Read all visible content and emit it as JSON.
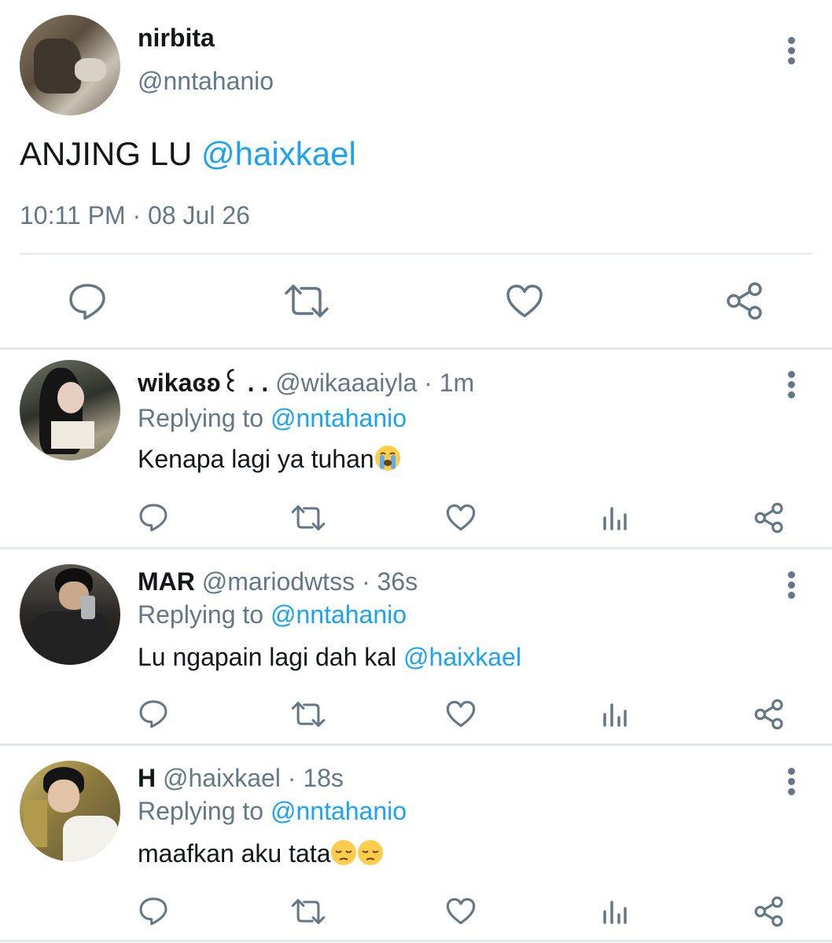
{
  "main_tweet": {
    "display_name": "nirbita",
    "handle": "@nntahanio",
    "text": "ANJING LU ",
    "mention": "@haixkael",
    "timestamp": "10:11 PM · 08 Jul 26"
  },
  "replies": [
    {
      "display_name": "wikaɞʚ꒰ . .",
      "handle_time": "@wikaaaiyla · 1m",
      "replying_prefix": "Replying to ",
      "replying_to": "@nntahanio",
      "text": "Kenapa lagi ya tuhan",
      "mention": "",
      "emojis": [
        "crying-face-emoji"
      ]
    },
    {
      "display_name": "MAR",
      "handle_time": "@mariodwtss · 36s",
      "replying_prefix": "Replying to ",
      "replying_to": "@nntahanio",
      "text": "Lu ngapain lagi dah kal ",
      "mention": "@haixkael",
      "emojis": []
    },
    {
      "display_name": "H",
      "handle_time": "@haixkael · 18s",
      "replying_prefix": "Replying to ",
      "replying_to": "@nntahanio",
      "text": "maafkan aku tata",
      "mention": "",
      "emojis": [
        "pensive-face-emoji",
        "pensive-face-emoji"
      ]
    }
  ],
  "icons": {
    "reply": "reply-icon",
    "retweet": "retweet-icon",
    "like": "heart-icon",
    "analytics": "analytics-icon",
    "share": "share-icon",
    "more": "more-vertical-icon"
  },
  "colors": {
    "link": "#1da1f2",
    "secondary_text": "#657786",
    "divider": "#e1e8ed"
  }
}
